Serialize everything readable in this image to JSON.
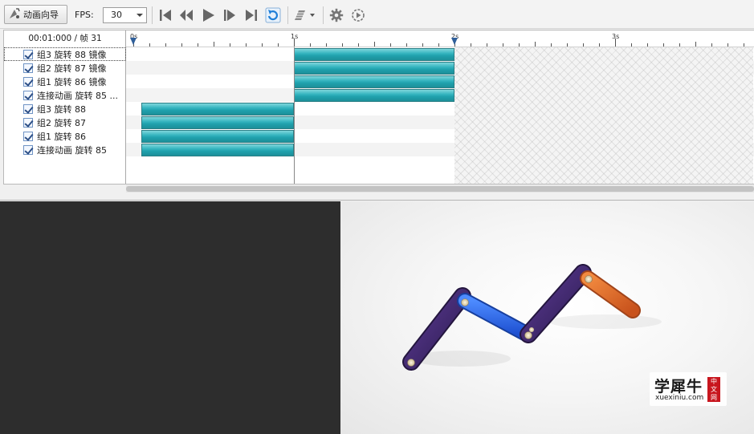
{
  "toolbar": {
    "wizard_label": "动画向导",
    "fps_label": "FPS:",
    "fps_value": "30",
    "icons": [
      "animation-wizard-icon",
      "skip-to-start-icon",
      "step-back-icon",
      "play-icon",
      "step-forward-icon",
      "skip-to-end-icon",
      "loop-icon",
      "keyframe-tools-icon",
      "settings-gear-icon",
      "record-icon"
    ]
  },
  "timeline": {
    "time_readout": "00:01:000 / 帧 31",
    "ruler_labels": [
      "0s",
      "1s",
      "2s",
      "3s"
    ],
    "tracks": [
      {
        "label": "组3 旋转 88 镜像",
        "checked": true,
        "start": 1,
        "end": 2
      },
      {
        "label": "组2 旋转 87 镜像",
        "checked": true,
        "start": 1,
        "end": 2
      },
      {
        "label": "组1 旋转 86 镜像",
        "checked": true,
        "start": 1,
        "end": 2
      },
      {
        "label": "连接动画 旋转 85 ...",
        "checked": true,
        "start": 1,
        "end": 2
      },
      {
        "label": "组3 旋转 88",
        "checked": true,
        "start": 0.05,
        "end": 1
      },
      {
        "label": "组2 旋转 87",
        "checked": true,
        "start": 0.05,
        "end": 1
      },
      {
        "label": "组1 旋转 86",
        "checked": true,
        "start": 0.05,
        "end": 1
      },
      {
        "label": "连接动画 旋转 85",
        "checked": true,
        "start": 0.05,
        "end": 1
      }
    ],
    "animation_end_seconds": 2,
    "current_time_seconds": 1,
    "accent_color": "#29aab5"
  },
  "viewport": {
    "watermark_title": "学犀牛",
    "watermark_url": "xuexiniu.com",
    "watermark_badge": "中文网",
    "colors": {
      "purple": "#4a2d7a",
      "blue": "#2a62e0",
      "orange": "#e2692a"
    }
  }
}
